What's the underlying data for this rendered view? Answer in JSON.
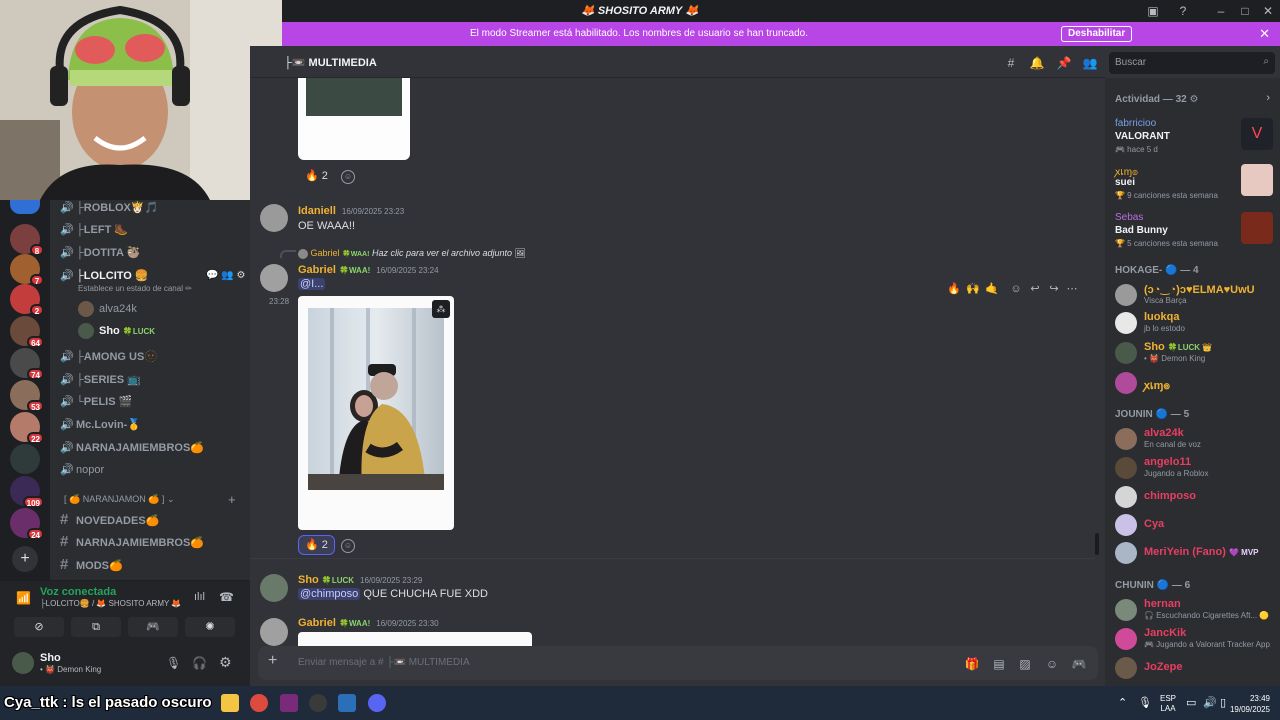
{
  "window": {
    "title": "🦊 SHOSITO ARMY 🦊"
  },
  "banner": {
    "text": "El modo Streamer está habilitado. Los nombres de usuario se han truncado.",
    "button": "Deshabilitar"
  },
  "rail_badges": [
    "8",
    "7",
    "2",
    "64",
    "74",
    "53",
    "22",
    "109",
    "24"
  ],
  "channels": [
    {
      "label": "├ROBLOX👸🏻🎵",
      "type": "voice"
    },
    {
      "label": "├LEFT 🥾",
      "type": "voice"
    },
    {
      "label": "├DOTITA 🦥",
      "type": "voice"
    },
    {
      "label": "├LOLCITO 🍔",
      "type": "voice",
      "active": true,
      "status": "Establece un estado de canal ✏"
    },
    {
      "label": "├AMONG US🫥",
      "type": "voice"
    },
    {
      "label": "├SERIES 📺",
      "type": "voice"
    },
    {
      "label": "└PELIS 🎬",
      "type": "voice"
    },
    {
      "label": "Mc.Lovin-🥇",
      "type": "voice"
    },
    {
      "label": "NARNAJAMIEMBROS🍊",
      "type": "voice"
    },
    {
      "label": "nopor",
      "type": "voice"
    }
  ],
  "voice_users": [
    {
      "name": "alva24k"
    },
    {
      "name": "Sho",
      "tag": "LUCK"
    }
  ],
  "category": {
    "label": "[ 🍊 NARANJAMON 🍊 ]"
  },
  "text_channels": [
    {
      "label": "NOVEDADES🍊"
    },
    {
      "label": "NARNAJAMIEMBROS🍊"
    },
    {
      "label": "MODS🍊"
    }
  ],
  "voice_panel": {
    "status": "Voz conectada",
    "location": "├LOLCITO🍔 / 🦊 SHOSITO ARMY 🦊"
  },
  "user_panel": {
    "name": "Sho",
    "status": "Demon King"
  },
  "chat": {
    "channel_name": "├📼 MULTIMEDIA",
    "composer_placeholder": "Enviar mensaje a # ├📼 MULTIMEDIA",
    "messages": [
      {
        "author": "Idaniell",
        "time": "16/09/2025 23:23",
        "text": "OE WAAA!!"
      },
      {
        "reply_author": "Gabriel",
        "reply_tag": "WAA!",
        "reply_text": "Haz clic para ver el archivo adjunto",
        "author": "Gabriel",
        "tag": "WAA!",
        "time": "16/09/2025 23:24",
        "text": "@I...",
        "side_time": "23:28"
      },
      {
        "author": "Sho",
        "tag": "LUCK",
        "time": "16/09/2025 23:29",
        "mention": "@chimposo",
        "text": "QUE CHUCHA FUE XDD"
      },
      {
        "author": "Gabriel",
        "tag": "WAA!",
        "time": "16/09/2025 23:30"
      }
    ],
    "reactions": [
      {
        "emoji": "🔥",
        "count": "2"
      },
      {
        "emoji": "🔥",
        "count": "2"
      }
    ]
  },
  "search": {
    "placeholder": "Buscar"
  },
  "members": {
    "activity_header": "Actividad — 32 ⚙",
    "activities": [
      {
        "name": "fabrricioo",
        "game": "VALORANT",
        "sub": "🎮 hace 5 d"
      },
      {
        "name": "ꭗเɱ๏",
        "game": "suei",
        "sub": "🏆 9 canciones esta semana"
      },
      {
        "name": "Sebas",
        "game": "Bad Bunny",
        "sub": "🏆 5 canciones esta semana"
      }
    ],
    "groups": [
      {
        "title": "HOKAGE- 🔵 — 4",
        "items": [
          {
            "name": "(ↄ◔‿◔)ↄ♥ELMA♥UwU",
            "sub": "Visca Barça",
            "color": "#f0b232"
          },
          {
            "name": "luokqa",
            "sub": "jb lo estodo",
            "color": "#f0b232"
          },
          {
            "name": "Sho",
            "tag": "LUCK 👑",
            "sub": "• 👹 Demon King",
            "color": "#f0b232"
          },
          {
            "name": "ꭗเɱ๏",
            "sub": "",
            "color": "#f0b232"
          }
        ]
      },
      {
        "title": "JOUNIN 🔵 — 5",
        "items": [
          {
            "name": "alva24k",
            "sub": "En canal de voz",
            "color": "#e83e62"
          },
          {
            "name": "angelo11",
            "sub": "Jugando a Roblox",
            "color": "#e83e62"
          },
          {
            "name": "chimposo",
            "sub": "",
            "color": "#e83e62"
          },
          {
            "name": "Cya",
            "sub": "",
            "color": "#e83e62"
          },
          {
            "name": "MeriYein (Fano)",
            "tag": "💜 MVP",
            "sub": "",
            "color": "#e83e62"
          }
        ]
      },
      {
        "title": "CHUNIN 🔵 — 6",
        "items": [
          {
            "name": "hernan",
            "sub": "🎧 Escuchando Cigarettes Aft... 🟡",
            "color": "#e83e62"
          },
          {
            "name": "JancKik",
            "sub": "🎮 Jugando a Valorant Tracker App",
            "color": "#e83e62"
          },
          {
            "name": "JoZepe",
            "sub": "",
            "color": "#e83e62"
          }
        ]
      }
    ]
  },
  "taskbar": {
    "ticker": "Cya_ttk : ls el pasado oscuro",
    "lang": "ESP",
    "lang_sub": "LAA",
    "time": "23:49",
    "date": "19/09/2025"
  }
}
